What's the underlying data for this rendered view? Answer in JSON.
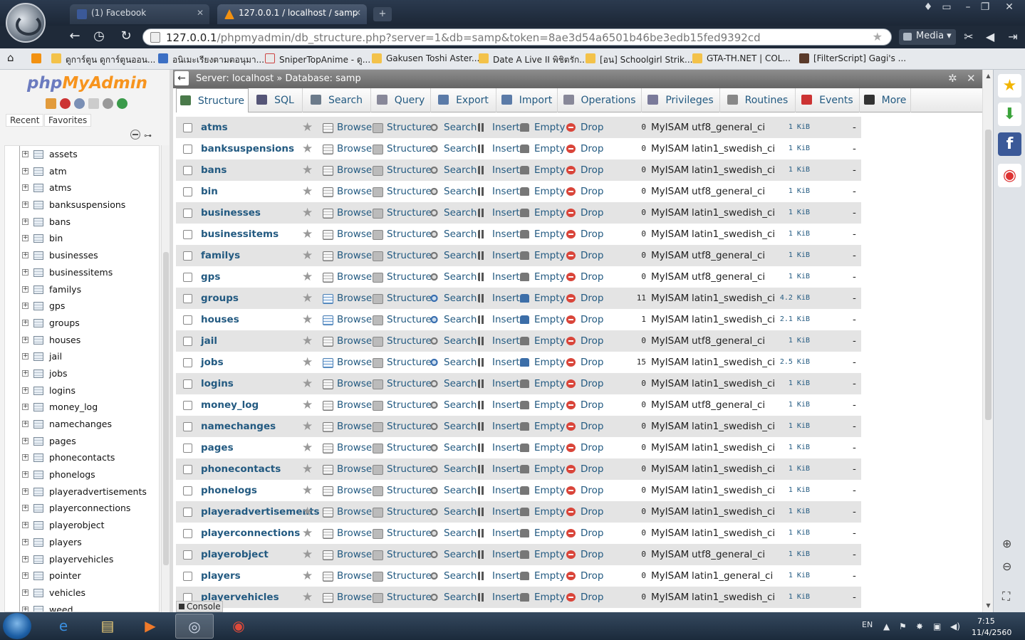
{
  "browser": {
    "tabs": [
      {
        "title": "(1) Facebook"
      },
      {
        "title": "127.0.0.1 / localhost / samp"
      }
    ],
    "url_host": "127.0.0.1",
    "url_path": "/phpmyadmin/db_structure.php?server=1&db=samp&token=8ae3d54a6501b46be3edb15fed9392cd",
    "media_label": "Media",
    "bookmarks": [
      "ดูการ์ตูน ดูการ์ตูนออน...",
      "อนิเมะเรียงตามตอนุมา...",
      "SniperTopAnime - ดู...",
      "Gakusen Toshi Aster...",
      "Date A Live II พิชิตรัก...",
      "[อน] Schoolgirl Strik...",
      "GTA-TH.NET | COL...",
      "[FilterScript] Gagi's ..."
    ]
  },
  "left": {
    "logo_part1": "php",
    "logo_part2": "MyAdmin",
    "tab_recent": "Recent",
    "tab_favorites": "Favorites",
    "tree": [
      "assets",
      "atm",
      "atms",
      "banksuspensions",
      "bans",
      "bin",
      "businesses",
      "businessitems",
      "familys",
      "gps",
      "groups",
      "houses",
      "jail",
      "jobs",
      "logins",
      "money_log",
      "namechanges",
      "pages",
      "phonecontacts",
      "phonelogs",
      "playeradvertisements",
      "playerconnections",
      "playerobject",
      "players",
      "playervehicles",
      "pointer",
      "vehicles",
      "weed"
    ]
  },
  "main": {
    "breadcrumb": {
      "server": "Server: localhost",
      "sep": "»",
      "database": "Database: samp"
    },
    "tabs": [
      "Structure",
      "SQL",
      "Search",
      "Query",
      "Export",
      "Import",
      "Operations",
      "Privileges",
      "Routines",
      "Events",
      "More"
    ],
    "action_labels": {
      "browse": "Browse",
      "structure": "Structure",
      "search": "Search",
      "insert": "Insert",
      "empty": "Empty",
      "drop": "Drop"
    },
    "tables": [
      {
        "name": "atms",
        "rows": "0",
        "engine": "MyISAM",
        "collation": "utf8_general_ci",
        "size": "1 KiB",
        "overhead": "-"
      },
      {
        "name": "banksuspensions",
        "rows": "0",
        "engine": "MyISAM",
        "collation": "latin1_swedish_ci",
        "size": "1 KiB",
        "overhead": "-"
      },
      {
        "name": "bans",
        "rows": "0",
        "engine": "MyISAM",
        "collation": "latin1_swedish_ci",
        "size": "1 KiB",
        "overhead": "-"
      },
      {
        "name": "bin",
        "rows": "0",
        "engine": "MyISAM",
        "collation": "utf8_general_ci",
        "size": "1 KiB",
        "overhead": "-"
      },
      {
        "name": "businesses",
        "rows": "0",
        "engine": "MyISAM",
        "collation": "latin1_swedish_ci",
        "size": "1 KiB",
        "overhead": "-"
      },
      {
        "name": "businessitems",
        "rows": "0",
        "engine": "MyISAM",
        "collation": "latin1_swedish_ci",
        "size": "1 KiB",
        "overhead": "-"
      },
      {
        "name": "familys",
        "rows": "0",
        "engine": "MyISAM",
        "collation": "utf8_general_ci",
        "size": "1 KiB",
        "overhead": "-"
      },
      {
        "name": "gps",
        "rows": "0",
        "engine": "MyISAM",
        "collation": "utf8_general_ci",
        "size": "1 KiB",
        "overhead": "-"
      },
      {
        "name": "groups",
        "rows": "11",
        "engine": "MyISAM",
        "collation": "latin1_swedish_ci",
        "size": "4.2 KiB",
        "overhead": "-"
      },
      {
        "name": "houses",
        "rows": "1",
        "engine": "MyISAM",
        "collation": "latin1_swedish_ci",
        "size": "2.1 KiB",
        "overhead": "-"
      },
      {
        "name": "jail",
        "rows": "0",
        "engine": "MyISAM",
        "collation": "utf8_general_ci",
        "size": "1 KiB",
        "overhead": "-"
      },
      {
        "name": "jobs",
        "rows": "15",
        "engine": "MyISAM",
        "collation": "latin1_swedish_ci",
        "size": "2.5 KiB",
        "overhead": "-"
      },
      {
        "name": "logins",
        "rows": "0",
        "engine": "MyISAM",
        "collation": "latin1_swedish_ci",
        "size": "1 KiB",
        "overhead": "-"
      },
      {
        "name": "money_log",
        "rows": "0",
        "engine": "MyISAM",
        "collation": "utf8_general_ci",
        "size": "1 KiB",
        "overhead": "-"
      },
      {
        "name": "namechanges",
        "rows": "0",
        "engine": "MyISAM",
        "collation": "latin1_swedish_ci",
        "size": "1 KiB",
        "overhead": "-"
      },
      {
        "name": "pages",
        "rows": "0",
        "engine": "MyISAM",
        "collation": "latin1_swedish_ci",
        "size": "1 KiB",
        "overhead": "-"
      },
      {
        "name": "phonecontacts",
        "rows": "0",
        "engine": "MyISAM",
        "collation": "latin1_swedish_ci",
        "size": "1 KiB",
        "overhead": "-"
      },
      {
        "name": "phonelogs",
        "rows": "0",
        "engine": "MyISAM",
        "collation": "latin1_swedish_ci",
        "size": "1 KiB",
        "overhead": "-"
      },
      {
        "name": "playeradvertisements",
        "rows": "0",
        "engine": "MyISAM",
        "collation": "latin1_swedish_ci",
        "size": "1 KiB",
        "overhead": "-"
      },
      {
        "name": "playerconnections",
        "rows": "0",
        "engine": "MyISAM",
        "collation": "latin1_swedish_ci",
        "size": "1 KiB",
        "overhead": "-"
      },
      {
        "name": "playerobject",
        "rows": "0",
        "engine": "MyISAM",
        "collation": "utf8_general_ci",
        "size": "1 KiB",
        "overhead": "-"
      },
      {
        "name": "players",
        "rows": "0",
        "engine": "MyISAM",
        "collation": "latin1_general_ci",
        "size": "1 KiB",
        "overhead": "-"
      },
      {
        "name": "playervehicles",
        "rows": "0",
        "engine": "MyISAM",
        "collation": "latin1_swedish_ci",
        "size": "1 KiB",
        "overhead": "-"
      }
    ],
    "console_label": "Console"
  },
  "taskbar": {
    "language": "EN",
    "time": "7:15",
    "date": "11/4/2560"
  },
  "colors": {
    "link": "#235a81",
    "logo_php": "#6b7bbf",
    "logo_myadmin": "#f7941e",
    "drop_red": "#d9453a"
  }
}
